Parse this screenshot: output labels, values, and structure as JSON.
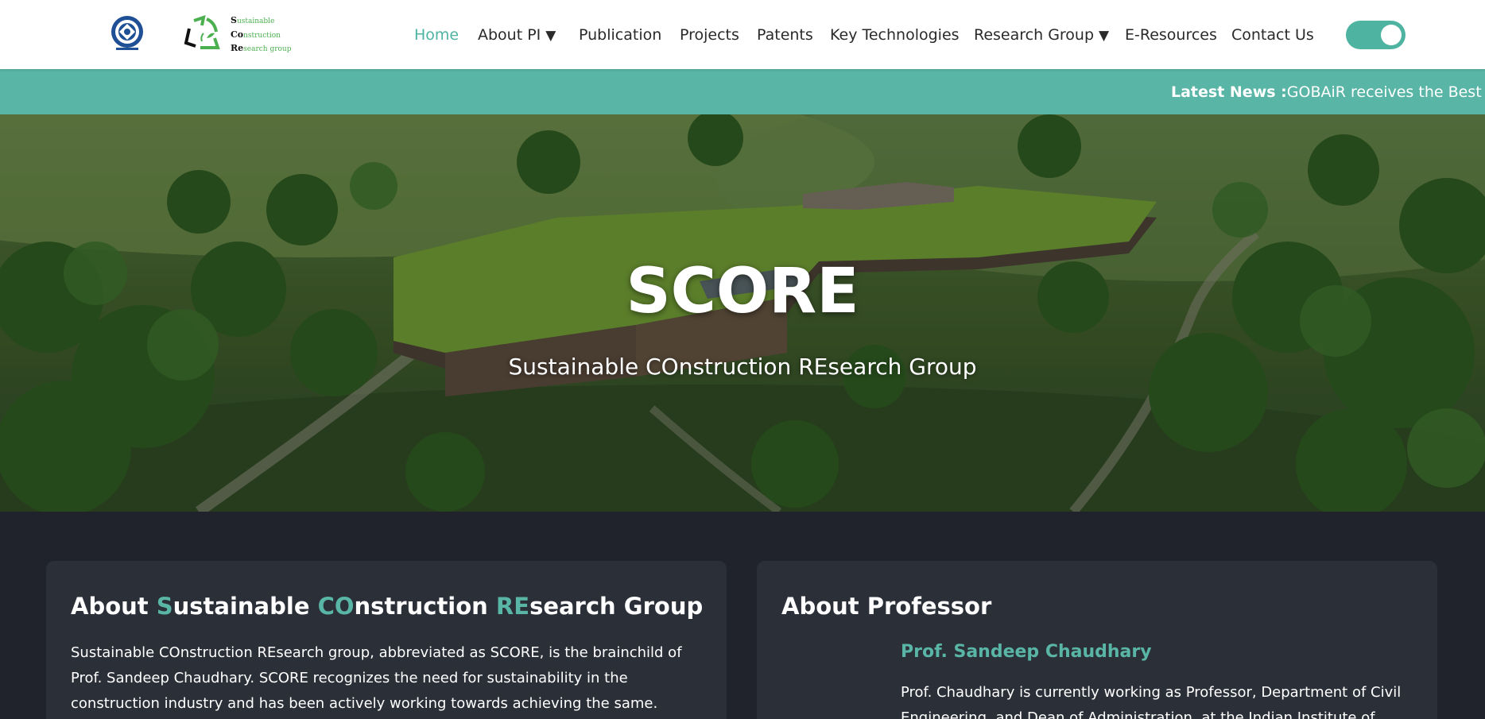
{
  "header": {
    "nav": [
      {
        "label": "Home",
        "active": true,
        "dropdown": false
      },
      {
        "label": "About PI",
        "active": false,
        "dropdown": true
      },
      {
        "label": "Publication",
        "active": false,
        "dropdown": false
      },
      {
        "label": "Projects",
        "active": false,
        "dropdown": false
      },
      {
        "label": "Patents",
        "active": false,
        "dropdown": false
      },
      {
        "label": "Key Technologies",
        "active": false,
        "dropdown": false
      },
      {
        "label": "Research Group",
        "active": false,
        "dropdown": true
      },
      {
        "label": "E-Resources",
        "active": false,
        "dropdown": false
      },
      {
        "label": "Contact Us",
        "active": false,
        "dropdown": false
      }
    ],
    "caret": "▼",
    "logo_lines": [
      {
        "initial": "S",
        "rest": "ustainable"
      },
      {
        "initial": "Co",
        "rest": "nstruction"
      },
      {
        "initial": "Re",
        "rest": "search group"
      }
    ],
    "theme_toggle_on": true
  },
  "news": {
    "label": "Latest News :",
    "text": "GOBAiR receives the Best Prod"
  },
  "hero": {
    "title": "SCORE",
    "subtitle": "Sustainable COnstruction REsearch Group"
  },
  "about_group": {
    "title_parts": [
      {
        "text": "About ",
        "hl": false
      },
      {
        "text": "S",
        "hl": true
      },
      {
        "text": "ustainable ",
        "hl": false
      },
      {
        "text": "CO",
        "hl": true
      },
      {
        "text": "nstruction ",
        "hl": false
      },
      {
        "text": "RE",
        "hl": true
      },
      {
        "text": "search Group",
        "hl": false
      }
    ],
    "body": "Sustainable COnstruction REsearch group, abbreviated as SCORE, is the brainchild of Prof. Sandeep Chaudhary. SCORE recognizes the need for sustainability in the construction industry and has been actively working towards achieving the same. SCORE is a multi-"
  },
  "about_professor": {
    "title": "About Professor",
    "name": "Prof. Sandeep Chaudhary",
    "body": "Prof. Chaudhary is currently working as Professor, Department of Civil Engineering, and Dean of Administration, at the Indian Institute of"
  },
  "colors": {
    "accent": "#59b5a5",
    "dark_bg": "#20232b",
    "card_bg": "#2b2f38"
  }
}
